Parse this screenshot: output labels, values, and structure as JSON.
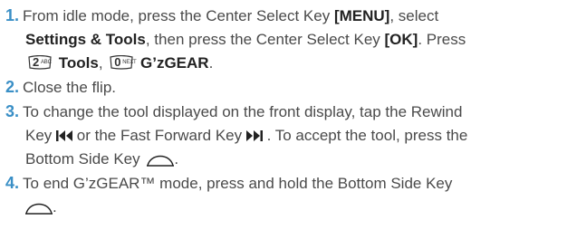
{
  "steps": [
    {
      "number": "1.",
      "t1": "From idle mode, press the Center Select Key ",
      "k1": "[MENU]",
      "t2": ", select",
      "k2": "Settings & Tools",
      "t3": ", then press the Center Select Key ",
      "k3": "[OK]",
      "t4": ". Press",
      "key_a_num": "2",
      "key_a_sub": "ABC",
      "k4": "Tools",
      "t5": ",",
      "key_b_num": "0",
      "key_b_sub": "NEXT",
      "k5": "G’zGEAR",
      "t6": "."
    },
    {
      "number": "2.",
      "t1": "Close the flip."
    },
    {
      "number": "3.",
      "t1": "To change the tool displayed on the front display, tap the Rewind",
      "t2": "Key",
      "t3": "or the Fast Forward Key",
      "t4": ". To accept the tool, press the",
      "t5": "Bottom Side Key",
      "t6": "."
    },
    {
      "number": "4.",
      "t1": "To end G’zGEAR™ mode, press and hold the Bottom Side Key",
      "t2": "."
    }
  ],
  "icons": {
    "rewind": "rewind-icon",
    "fast_forward": "fast-forward-icon",
    "bottom_side_key": "bottom-side-key-icon",
    "keypad_key": "keypad-key-icon"
  },
  "colors": {
    "step_number": "#3a8fc6",
    "text": "#4a4a4a"
  }
}
